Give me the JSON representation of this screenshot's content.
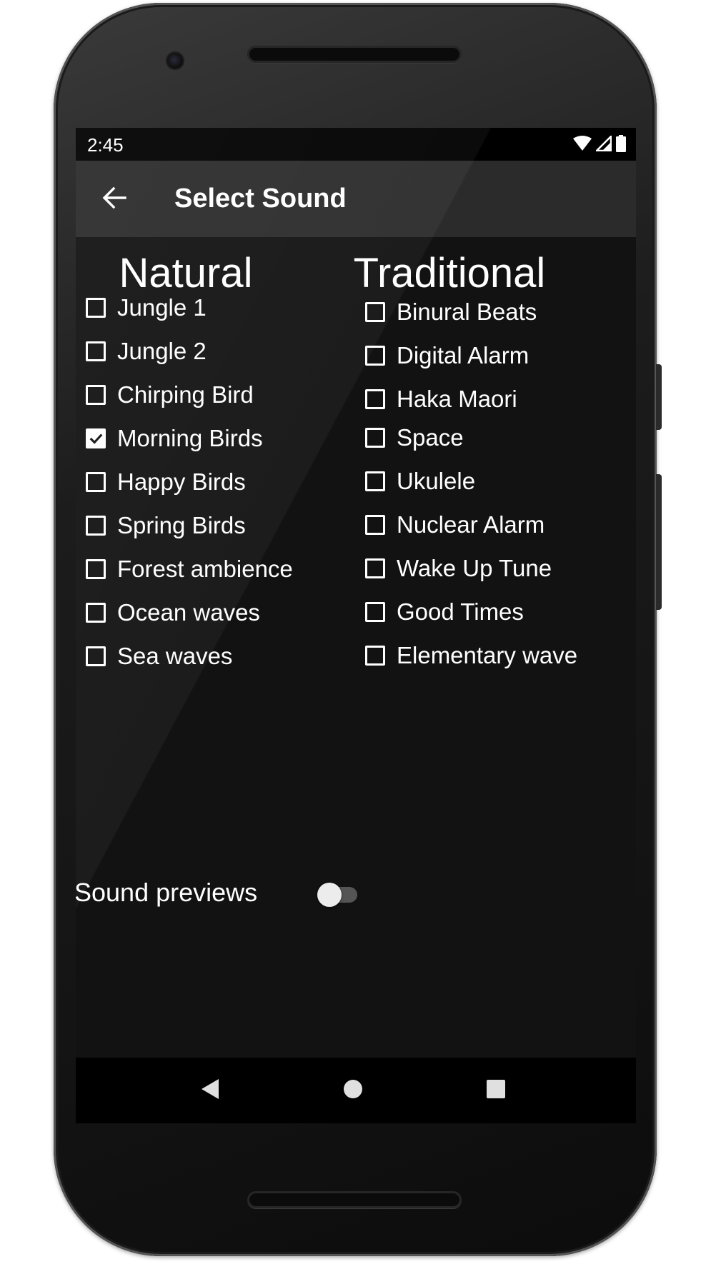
{
  "status_bar": {
    "time": "2:45",
    "icons": [
      "wifi-icon",
      "signal-icon",
      "battery-icon"
    ]
  },
  "app_bar": {
    "back_icon": "arrow-back-icon",
    "title": "Select Sound"
  },
  "natural": {
    "title": "Natural",
    "items": [
      {
        "label": "Jungle 1",
        "checked": false
      },
      {
        "label": "Jungle 2",
        "checked": false
      },
      {
        "label": "Chirping Bird",
        "checked": false
      },
      {
        "label": "Morning Birds",
        "checked": true
      },
      {
        "label": "Happy Birds",
        "checked": false
      },
      {
        "label": "Spring Birds",
        "checked": false
      },
      {
        "label": "Forest ambience",
        "checked": false
      },
      {
        "label": "Ocean waves",
        "checked": false
      },
      {
        "label": "Sea waves",
        "checked": false
      }
    ]
  },
  "traditional": {
    "title": "Traditional",
    "items": [
      {
        "label": "Binural Beats",
        "checked": false
      },
      {
        "label": "Digital Alarm",
        "checked": false
      },
      {
        "label": "Haka Maori",
        "checked": false
      },
      {
        "label": "Space",
        "checked": false
      },
      {
        "label": "Ukulele",
        "checked": false
      },
      {
        "label": "Nuclear Alarm",
        "checked": false
      },
      {
        "label": "Wake Up Tune",
        "checked": false
      },
      {
        "label": "Good Times",
        "checked": false
      },
      {
        "label": "Elementary wave",
        "checked": false
      }
    ]
  },
  "sound_previews": {
    "label": "Sound previews",
    "enabled": false
  },
  "nav_bar": {
    "icons": [
      "nav-back-icon",
      "nav-home-icon",
      "nav-recents-icon"
    ]
  },
  "colors": {
    "screen_background": "#121212",
    "app_bar": "#2b2b2b",
    "status_bar": "#000000",
    "text": "#ffffff"
  }
}
